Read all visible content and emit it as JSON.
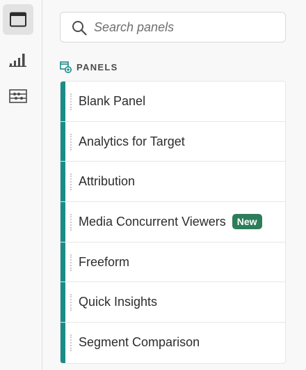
{
  "rail": {
    "items": [
      {
        "icon": "panels-icon",
        "active": true
      },
      {
        "icon": "visualizations-icon",
        "active": false
      },
      {
        "icon": "components-icon",
        "active": false
      }
    ]
  },
  "search": {
    "placeholder": "Search panels",
    "value": ""
  },
  "section": {
    "icon": "panels-add-icon",
    "title": "PANELS"
  },
  "panels": [
    {
      "label": "Blank Panel",
      "badge": ""
    },
    {
      "label": "Analytics for Target",
      "badge": ""
    },
    {
      "label": "Attribution",
      "badge": ""
    },
    {
      "label": "Media Concurrent Viewers",
      "badge": "New"
    },
    {
      "label": "Freeform",
      "badge": ""
    },
    {
      "label": "Quick Insights",
      "badge": ""
    },
    {
      "label": "Segment Comparison",
      "badge": ""
    }
  ],
  "colors": {
    "accent": "#1a8c88",
    "badge": "#2d7d5a",
    "section_icon": "#1a8c88"
  }
}
